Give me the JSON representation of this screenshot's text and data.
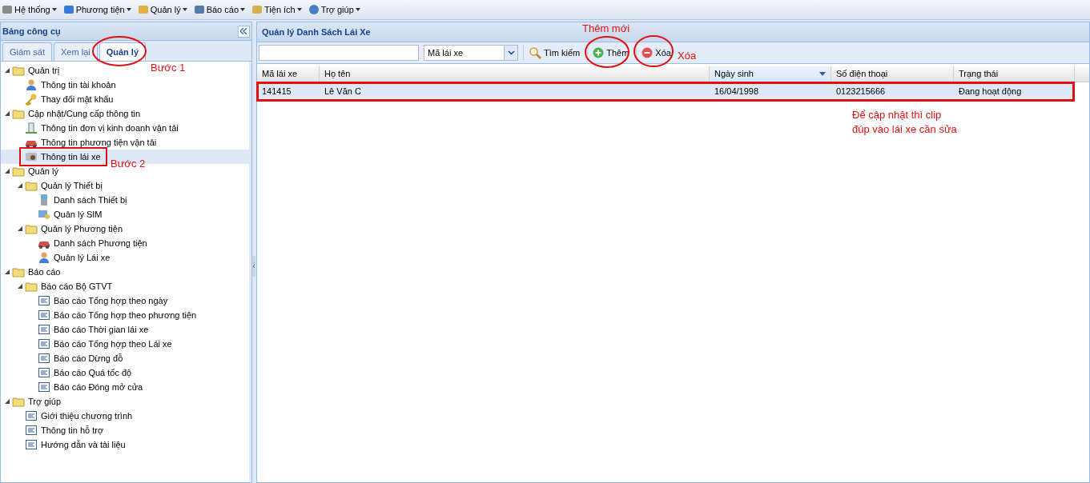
{
  "menu": [
    {
      "label": "Hệ thống"
    },
    {
      "label": "Phương tiện"
    },
    {
      "label": "Quản lý"
    },
    {
      "label": "Báo cáo"
    },
    {
      "label": "Tiện ích"
    },
    {
      "label": "Trợ giúp"
    }
  ],
  "sidebar": {
    "title": "Bảng công cụ",
    "tabs": [
      {
        "label": "Giám sát",
        "selected": false
      },
      {
        "label": "Xem lại",
        "selected": false
      },
      {
        "label": "Quản lý",
        "selected": true
      }
    ],
    "tree": [
      {
        "label": "Quản trị",
        "kind": "folder",
        "expanded": true,
        "selected": false,
        "children": [
          {
            "label": "Thông tin tài khoản",
            "kind": "user",
            "selected": false
          },
          {
            "label": "Thay đổi mật khẩu",
            "kind": "key",
            "selected": false
          }
        ]
      },
      {
        "label": "Cập nhật/Cung cấp thông tin",
        "kind": "folder",
        "expanded": true,
        "selected": false,
        "children": [
          {
            "label": "Thông tin đơn vị kinh doanh vận tải",
            "kind": "building",
            "selected": false
          },
          {
            "label": "Thông tin phương tiện vận tải",
            "kind": "car",
            "selected": false
          },
          {
            "label": "Thông tin lái xe",
            "kind": "card",
            "selected": true
          }
        ]
      },
      {
        "label": "Quản lý",
        "kind": "folder",
        "expanded": true,
        "selected": false,
        "children": [
          {
            "label": "Quản lý Thiết bị",
            "kind": "folder",
            "expanded": true,
            "selected": false,
            "children": [
              {
                "label": "Danh sách Thiết bị",
                "kind": "phone",
                "selected": false
              },
              {
                "label": "Quản lý SIM",
                "kind": "sim",
                "selected": false
              }
            ]
          },
          {
            "label": "Quản lý Phương tiện",
            "kind": "folder",
            "expanded": true,
            "selected": false,
            "children": [
              {
                "label": "Danh sách Phương tiện",
                "kind": "car",
                "selected": false
              },
              {
                "label": "Quản lý Lái xe",
                "kind": "user",
                "selected": false
              }
            ]
          }
        ]
      },
      {
        "label": "Báo cáo",
        "kind": "folder",
        "expanded": true,
        "selected": false,
        "children": [
          {
            "label": "Báo cáo Bộ GTVT",
            "kind": "folder",
            "expanded": true,
            "selected": false,
            "children": [
              {
                "label": "Báo cáo Tổng hợp theo ngày",
                "kind": "report",
                "selected": false
              },
              {
                "label": "Báo cáo Tổng hợp theo phương tiện",
                "kind": "report",
                "selected": false
              },
              {
                "label": "Báo cáo Thời gian lái xe",
                "kind": "report",
                "selected": false
              },
              {
                "label": "Báo cáo Tổng hợp theo Lái xe",
                "kind": "report",
                "selected": false
              },
              {
                "label": "Báo cáo Dừng đỗ",
                "kind": "report",
                "selected": false
              },
              {
                "label": "Báo cáo Quá tốc độ",
                "kind": "report",
                "selected": false
              },
              {
                "label": "Báo cáo Đóng mở cửa",
                "kind": "report",
                "selected": false
              }
            ]
          }
        ]
      },
      {
        "label": "Trợ giúp",
        "kind": "folder",
        "expanded": true,
        "selected": false,
        "children": [
          {
            "label": "Giới thiệu chương trình",
            "kind": "report",
            "selected": false
          },
          {
            "label": "Thông tin hỗ trợ",
            "kind": "report",
            "selected": false
          },
          {
            "label": "Hướng dẫn và tài liệu",
            "kind": "report",
            "selected": false
          }
        ]
      }
    ]
  },
  "main": {
    "title": "Quản lý Danh Sách Lái Xe",
    "toolbar": {
      "filter": "Mã lái xe",
      "buttons": [
        {
          "label": "Tìm kiếm",
          "kind": "search"
        },
        {
          "label": "Thêm",
          "kind": "add"
        },
        {
          "label": "Xóa",
          "kind": "delete"
        }
      ]
    },
    "table": {
      "columns": [
        {
          "label": "Mã lái xe",
          "sorted": false
        },
        {
          "label": "Họ tên",
          "sorted": false
        },
        {
          "label": "Ngày sinh",
          "sorted": true
        },
        {
          "label": "Số điện thoại",
          "sorted": false
        },
        {
          "label": "Trạng thái",
          "sorted": false
        }
      ],
      "rows": [
        {
          "cells": [
            "141415",
            "Lê Văn C",
            "16/04/1998",
            "0123215666",
            "Đang hoạt động"
          ],
          "selected": true
        }
      ]
    }
  },
  "annotations": [
    {
      "text": "Bước 1"
    },
    {
      "text": "Bước 2"
    },
    {
      "text": "Thêm mới"
    },
    {
      "text": "Xóa"
    },
    {
      "text": "Để cập nhật thì clip\nđúp vào lái xe cần sửa"
    }
  ]
}
